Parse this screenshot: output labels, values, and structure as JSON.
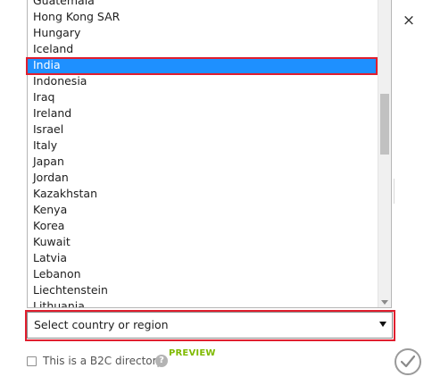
{
  "country_list": {
    "items": [
      {
        "label": "Guatemala",
        "selected": false
      },
      {
        "label": "Hong Kong SAR",
        "selected": false
      },
      {
        "label": "Hungary",
        "selected": false
      },
      {
        "label": "Iceland",
        "selected": false
      },
      {
        "label": "India",
        "selected": true
      },
      {
        "label": "Indonesia",
        "selected": false
      },
      {
        "label": "Iraq",
        "selected": false
      },
      {
        "label": "Ireland",
        "selected": false
      },
      {
        "label": "Israel",
        "selected": false
      },
      {
        "label": "Italy",
        "selected": false
      },
      {
        "label": "Japan",
        "selected": false
      },
      {
        "label": "Jordan",
        "selected": false
      },
      {
        "label": "Kazakhstan",
        "selected": false
      },
      {
        "label": "Kenya",
        "selected": false
      },
      {
        "label": "Korea",
        "selected": false
      },
      {
        "label": "Kuwait",
        "selected": false
      },
      {
        "label": "Latvia",
        "selected": false
      },
      {
        "label": "Lebanon",
        "selected": false
      },
      {
        "label": "Liechtenstein",
        "selected": false
      },
      {
        "label": "Lithuania",
        "selected": false
      }
    ]
  },
  "country_select": {
    "value": "Select country or region"
  },
  "b2c": {
    "label": "This is a B2C directory.",
    "checked": false,
    "help_icon": "question-circle-icon",
    "preview_label": "PREVIEW"
  },
  "dialog": {
    "close_symbol": "×",
    "confirm_icon": "checkmark-icon"
  },
  "colors": {
    "selected_item_bg": "#1e90ff",
    "highlight_border": "#e01e2e",
    "preview_green": "#7fba00"
  }
}
